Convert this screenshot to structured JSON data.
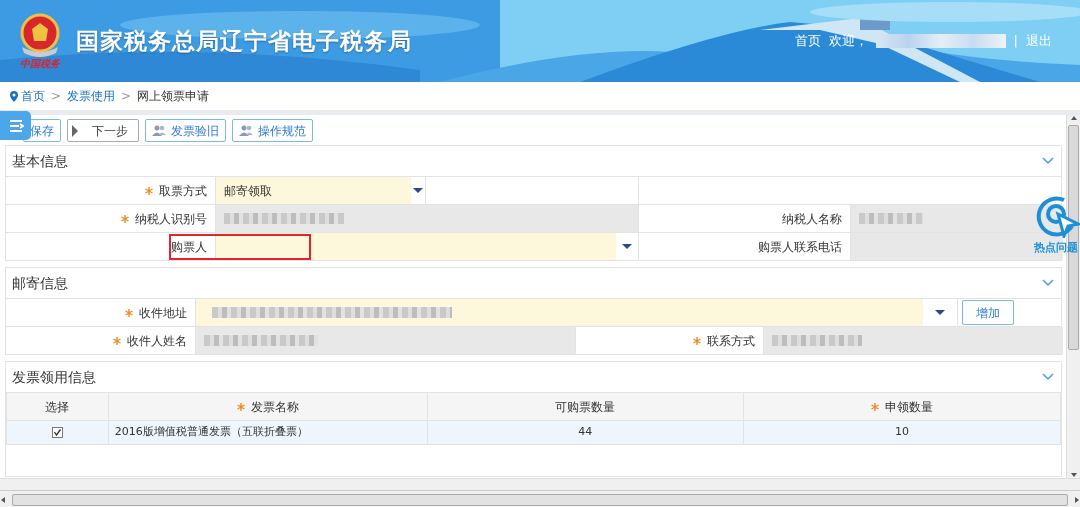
{
  "header": {
    "title": "国家税务总局辽宁省电子税务局",
    "logo_caption": "中国税务",
    "home": "首页",
    "welcome": "欢迎，",
    "divider": "|",
    "logout": "退出"
  },
  "breadcrumb": [
    {
      "label": "首页",
      "kind": "home"
    },
    {
      "label": ">",
      "kind": "separator"
    },
    {
      "label": "发票使用",
      "kind": "link"
    },
    {
      "label": ">",
      "kind": "separator"
    },
    {
      "label": "网上领票申请",
      "kind": "current"
    }
  ],
  "toolbar": [
    {
      "label": "保存",
      "kind": "save"
    },
    {
      "label": "下一步",
      "kind": "next"
    },
    {
      "label": "发票验旧",
      "kind": "action"
    },
    {
      "label": "操作规范",
      "kind": "action"
    }
  ],
  "sections": [
    {
      "title": "基本信息",
      "expanded": true,
      "rows": [
        [
          {
            "kind": "label",
            "text": "取票方式",
            "required": true
          },
          {
            "kind": "select",
            "value": "邮寄领取"
          },
          {
            "kind": "empty"
          },
          {
            "kind": "empty"
          }
        ],
        [
          {
            "kind": "label",
            "text": "纳税人识别号",
            "required": true
          },
          {
            "kind": "masked"
          },
          {
            "kind": "label",
            "text": "纳税人名称",
            "required": false
          },
          {
            "kind": "masked"
          }
        ],
        [
          {
            "kind": "label",
            "text": "购票人",
            "required": false,
            "highlighted": true
          },
          {
            "kind": "select"
          },
          {
            "kind": "label",
            "text": "购票人联系电话",
            "required": false
          },
          {
            "kind": "readonly"
          }
        ]
      ]
    },
    {
      "title": "邮寄信息",
      "expanded": true,
      "rows": [
        [
          {
            "kind": "label",
            "text": "收件地址",
            "required": true
          },
          {
            "kind": "select",
            "masked": true
          },
          {
            "kind": "button",
            "text": "增加"
          }
        ],
        [
          {
            "kind": "label",
            "text": "收件人姓名",
            "required": true
          },
          {
            "kind": "masked"
          },
          {
            "kind": "label",
            "text": "联系方式",
            "required": true
          },
          {
            "kind": "masked"
          }
        ]
      ]
    }
  ],
  "invoice": {
    "title": "发票领用信息",
    "expanded": true,
    "columns": [
      {
        "label": "选择",
        "required": false
      },
      {
        "label": "发票名称",
        "required": true
      },
      {
        "label": "可购票数量",
        "required": false
      },
      {
        "label": "申领数量",
        "required": true
      }
    ],
    "rows": [
      {
        "checked": true,
        "selected": true,
        "name": "2016版增值税普通发票（五联折叠票）",
        "available": "44",
        "quantity": "10"
      }
    ]
  },
  "help_widget": {
    "label": "热点问题"
  }
}
